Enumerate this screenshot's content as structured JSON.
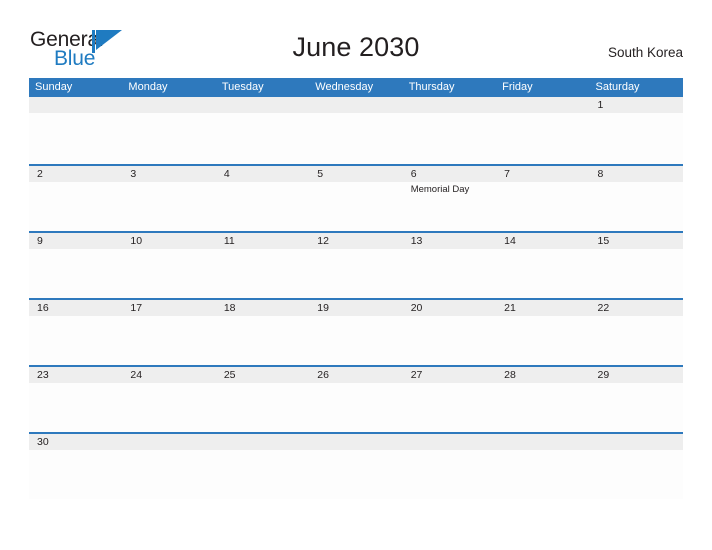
{
  "brand": {
    "name_part1": "General",
    "name_part2": "Blue",
    "flag_icon": "blue-flag-triangle",
    "color_dark": "#231f20",
    "color_blue": "#1f7bc1"
  },
  "header": {
    "title": "June 2030",
    "region": "South Korea"
  },
  "theme": {
    "header_blue": "#2e79bd",
    "rule_blue": "#2e79bd",
    "daynum_band": "#eeeeee",
    "cell_background": "#fdfdfd",
    "text": "#231f20"
  },
  "calendar": {
    "weekdays": [
      "Sunday",
      "Monday",
      "Tuesday",
      "Wednesday",
      "Thursday",
      "Friday",
      "Saturday"
    ],
    "weeks": [
      {
        "days": [
          {
            "num": "",
            "event": ""
          },
          {
            "num": "",
            "event": ""
          },
          {
            "num": "",
            "event": ""
          },
          {
            "num": "",
            "event": ""
          },
          {
            "num": "",
            "event": ""
          },
          {
            "num": "",
            "event": ""
          },
          {
            "num": "1",
            "event": ""
          }
        ]
      },
      {
        "days": [
          {
            "num": "2",
            "event": ""
          },
          {
            "num": "3",
            "event": ""
          },
          {
            "num": "4",
            "event": ""
          },
          {
            "num": "5",
            "event": ""
          },
          {
            "num": "6",
            "event": "Memorial Day"
          },
          {
            "num": "7",
            "event": ""
          },
          {
            "num": "8",
            "event": ""
          }
        ]
      },
      {
        "days": [
          {
            "num": "9",
            "event": ""
          },
          {
            "num": "10",
            "event": ""
          },
          {
            "num": "11",
            "event": ""
          },
          {
            "num": "12",
            "event": ""
          },
          {
            "num": "13",
            "event": ""
          },
          {
            "num": "14",
            "event": ""
          },
          {
            "num": "15",
            "event": ""
          }
        ]
      },
      {
        "days": [
          {
            "num": "16",
            "event": ""
          },
          {
            "num": "17",
            "event": ""
          },
          {
            "num": "18",
            "event": ""
          },
          {
            "num": "19",
            "event": ""
          },
          {
            "num": "20",
            "event": ""
          },
          {
            "num": "21",
            "event": ""
          },
          {
            "num": "22",
            "event": ""
          }
        ]
      },
      {
        "days": [
          {
            "num": "23",
            "event": ""
          },
          {
            "num": "24",
            "event": ""
          },
          {
            "num": "25",
            "event": ""
          },
          {
            "num": "26",
            "event": ""
          },
          {
            "num": "27",
            "event": ""
          },
          {
            "num": "28",
            "event": ""
          },
          {
            "num": "29",
            "event": ""
          }
        ]
      },
      {
        "days": [
          {
            "num": "30",
            "event": ""
          },
          {
            "num": "",
            "event": ""
          },
          {
            "num": "",
            "event": ""
          },
          {
            "num": "",
            "event": ""
          },
          {
            "num": "",
            "event": ""
          },
          {
            "num": "",
            "event": ""
          },
          {
            "num": "",
            "event": ""
          }
        ]
      }
    ]
  }
}
